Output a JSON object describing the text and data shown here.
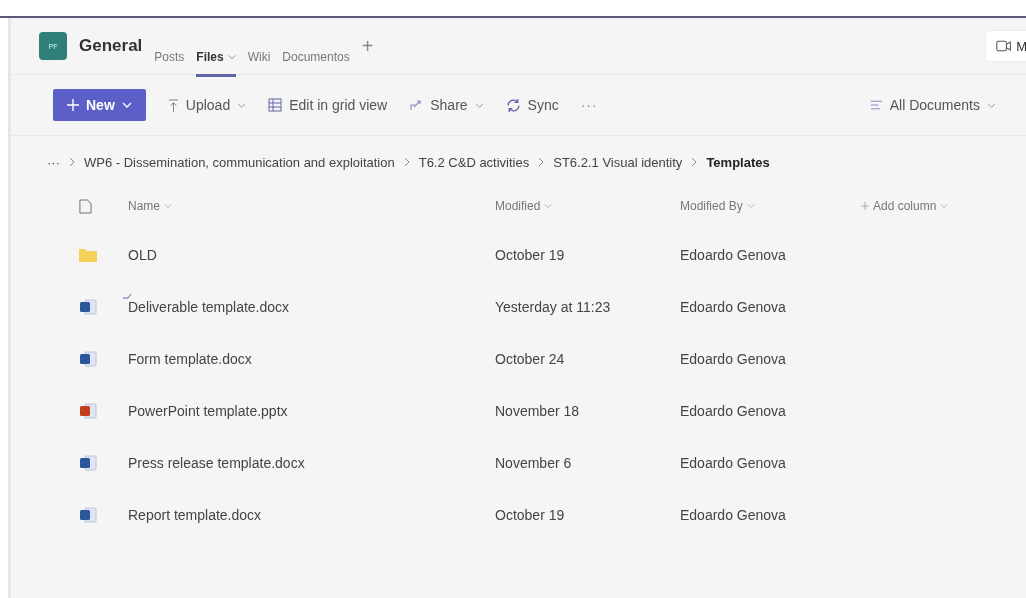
{
  "channel": {
    "avatar": "PF",
    "name": "General"
  },
  "tabs": [
    {
      "label": "Posts",
      "selected": false,
      "dropdown": false
    },
    {
      "label": "Files",
      "selected": true,
      "dropdown": true
    },
    {
      "label": "Wiki",
      "selected": false,
      "dropdown": false
    },
    {
      "label": "Documentos",
      "selected": false,
      "dropdown": false
    }
  ],
  "add_tab": "+",
  "meet_button": {
    "label": "M"
  },
  "toolbar": {
    "new_button": "New",
    "actions": [
      {
        "kind": "upload",
        "label": "Upload",
        "dropdown": true
      },
      {
        "kind": "grid",
        "label": "Edit in grid view",
        "dropdown": false
      },
      {
        "kind": "share",
        "label": "Share",
        "dropdown": true
      },
      {
        "kind": "sync",
        "label": "Sync",
        "dropdown": false
      }
    ],
    "more": "···",
    "view": "All Documents"
  },
  "breadcrumb": {
    "overflow": "···",
    "items": [
      "WP6 - Dissemination, communication and exploitation",
      "T6.2 C&D activities",
      "ST6.2.1 Visual identity",
      "Templates"
    ]
  },
  "table": {
    "columns": [
      "Name",
      "Modified",
      "Modified By",
      "Add column"
    ],
    "rows": [
      {
        "kind": "folder",
        "name": "OLD",
        "modified": "October 19",
        "modified_by": "Edoardo Genova",
        "new": false
      },
      {
        "kind": "word",
        "name": "Deliverable template.docx",
        "modified": "Yesterday at 11:23",
        "modified_by": "Edoardo Genova",
        "new": true
      },
      {
        "kind": "word",
        "name": "Form template.docx",
        "modified": "October 24",
        "modified_by": "Edoardo Genova",
        "new": false
      },
      {
        "kind": "powerpoint",
        "name": "PowerPoint template.pptx",
        "modified": "November 18",
        "modified_by": "Edoardo Genova",
        "new": false
      },
      {
        "kind": "word",
        "name": "Press release template.docx",
        "modified": "November 6",
        "modified_by": "Edoardo Genova",
        "new": false
      },
      {
        "kind": "word",
        "name": "Report template.docx",
        "modified": "October 19",
        "modified_by": "Edoardo Genova",
        "new": false
      }
    ]
  }
}
